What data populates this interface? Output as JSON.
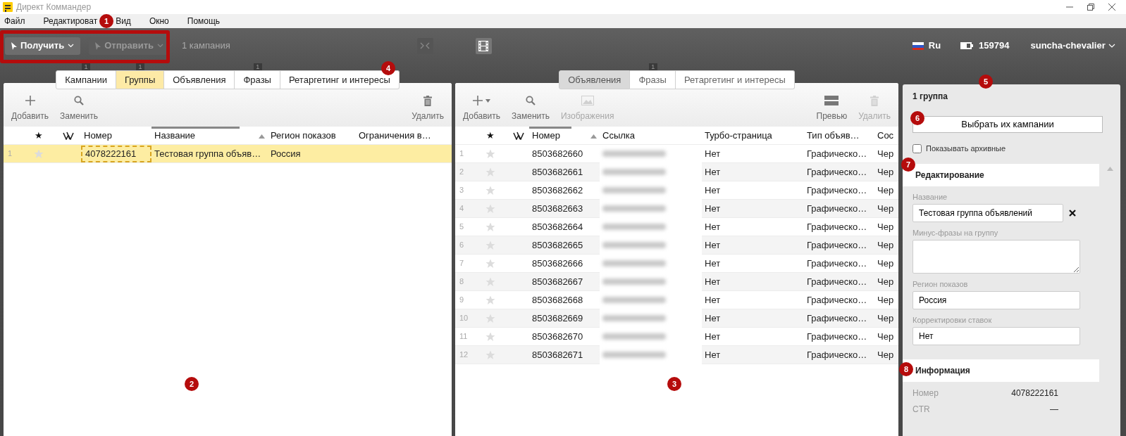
{
  "window": {
    "title": "Директ Коммандер"
  },
  "menu": [
    "Файл",
    "Редактироват",
    "Вид",
    "Окно",
    "Помощь"
  ],
  "toolbar": {
    "buttons": [
      {
        "label": "Получить",
        "disabled": false
      },
      {
        "label": "Отправить",
        "disabled": true
      }
    ],
    "campaigns_count": "1 кампания",
    "language": "Ru",
    "balance": "159794",
    "user": "suncha-chevalier"
  },
  "left_panel": {
    "active": true,
    "tabs": [
      {
        "label": "Кампании",
        "selected": false,
        "counter": "1"
      },
      {
        "label": "Группы",
        "selected": true,
        "counter": "1"
      },
      {
        "label": "Объявления",
        "selected": false
      },
      {
        "label": "Фразы",
        "selected": false,
        "counter": "1"
      },
      {
        "label": "Ретаргетинг и интересы",
        "selected": false
      }
    ],
    "actions": [
      {
        "label": "Добавить",
        "kind": "plus",
        "disabled": false
      },
      {
        "label": "Заменить",
        "kind": "search",
        "disabled": false
      }
    ],
    "right_actions": [
      {
        "label": "Удалить",
        "kind": "trash",
        "disabled": false
      }
    ],
    "star_header": "★",
    "columns": [
      {
        "label": "Номер",
        "sorted": false
      },
      {
        "label": "Название",
        "sorted": true
      },
      {
        "label": "Регион показов",
        "sorted": false
      },
      {
        "label": "Ограничения в…",
        "sorted": false
      }
    ],
    "rows": [
      {
        "index": "1",
        "starred": false,
        "selected": true,
        "focused_number": true,
        "cells": [
          "4078222161",
          "Тестовая группа объяв…",
          "Россия"
        ]
      }
    ]
  },
  "middle_panel": {
    "active": false,
    "tabs": [
      {
        "label": "Объявления",
        "selected": true
      },
      {
        "label": "Фразы",
        "selected": false,
        "counter": "1"
      },
      {
        "label": "Ретаргетинг и интересы",
        "selected": false
      }
    ],
    "actions": [
      {
        "label": "Добавить",
        "kind": "plus",
        "disabled": false,
        "dropdown": true
      },
      {
        "label": "Заменить",
        "kind": "search",
        "disabled": false
      },
      {
        "label": "Изображения",
        "kind": "image",
        "disabled": true
      }
    ],
    "right_actions": [
      {
        "label": "Превью",
        "kind": "preview",
        "disabled": false
      },
      {
        "label": "Удалить",
        "kind": "trash",
        "disabled": true
      }
    ],
    "star_header": "★",
    "columns": [
      {
        "label": "Номер",
        "sorted": true
      },
      {
        "label": "Ссылка",
        "sorted": false
      },
      {
        "label": "Турбо-страница",
        "sorted": false
      },
      {
        "label": "Тип объяв…",
        "sorted": false
      },
      {
        "label": "Сос",
        "sorted": false
      }
    ],
    "rows": [
      {
        "index": "1",
        "starred": false,
        "number": "8503682660",
        "turbo": "Нет",
        "type": "Графическо…",
        "status": "Чер"
      },
      {
        "index": "2",
        "starred": false,
        "number": "8503682661",
        "turbo": "Нет",
        "type": "Графическо…",
        "status": "Чер"
      },
      {
        "index": "3",
        "starred": false,
        "number": "8503682662",
        "turbo": "Нет",
        "type": "Графическо…",
        "status": "Чер"
      },
      {
        "index": "4",
        "starred": false,
        "number": "8503682663",
        "turbo": "Нет",
        "type": "Графическо…",
        "status": "Чер"
      },
      {
        "index": "5",
        "starred": false,
        "number": "8503682664",
        "turbo": "Нет",
        "type": "Графическо…",
        "status": "Чер"
      },
      {
        "index": "6",
        "starred": false,
        "number": "8503682665",
        "turbo": "Нет",
        "type": "Графическо…",
        "status": "Чер"
      },
      {
        "index": "7",
        "starred": false,
        "number": "8503682666",
        "turbo": "Нет",
        "type": "Графическо…",
        "status": "Чер"
      },
      {
        "index": "8",
        "starred": false,
        "number": "8503682667",
        "turbo": "Нет",
        "type": "Графическо…",
        "status": "Чер"
      },
      {
        "index": "9",
        "starred": false,
        "number": "8503682668",
        "turbo": "Нет",
        "type": "Графическо…",
        "status": "Чер"
      },
      {
        "index": "10",
        "starred": false,
        "number": "8503682669",
        "turbo": "Нет",
        "type": "Графическо…",
        "status": "Чер"
      },
      {
        "index": "11",
        "starred": false,
        "number": "8503682670",
        "turbo": "Нет",
        "type": "Графическо…",
        "status": "Чер"
      },
      {
        "index": "12",
        "starred": false,
        "number": "8503682671",
        "turbo": "Нет",
        "type": "Графическо…",
        "status": "Чер"
      }
    ]
  },
  "side_panel": {
    "title": "1 группа",
    "button": "Выбрать их кампании",
    "show_archived": {
      "label": "Показывать архивные",
      "checked": false
    },
    "editing": {
      "title": "Редактирование",
      "fields": [
        {
          "label": "Название",
          "value": "Тестовая группа объявлений",
          "kind": "input",
          "clearable": true
        },
        {
          "label": "Минус-фразы на группу",
          "kind": "textarea"
        },
        {
          "label": "Регион показов",
          "value": "Россия",
          "kind": "input"
        },
        {
          "label": "Корректировки ставок",
          "value": "Нет",
          "kind": "input"
        }
      ]
    },
    "info": {
      "title": "Информация",
      "rows": [
        {
          "label": "Номер",
          "value": "4078222161"
        },
        {
          "label": "CTR",
          "value": "—"
        }
      ]
    }
  },
  "annotations": {
    "frame": true,
    "markers": [
      "1",
      "2",
      "3",
      "4",
      "5",
      "6",
      "7",
      "8"
    ]
  }
}
